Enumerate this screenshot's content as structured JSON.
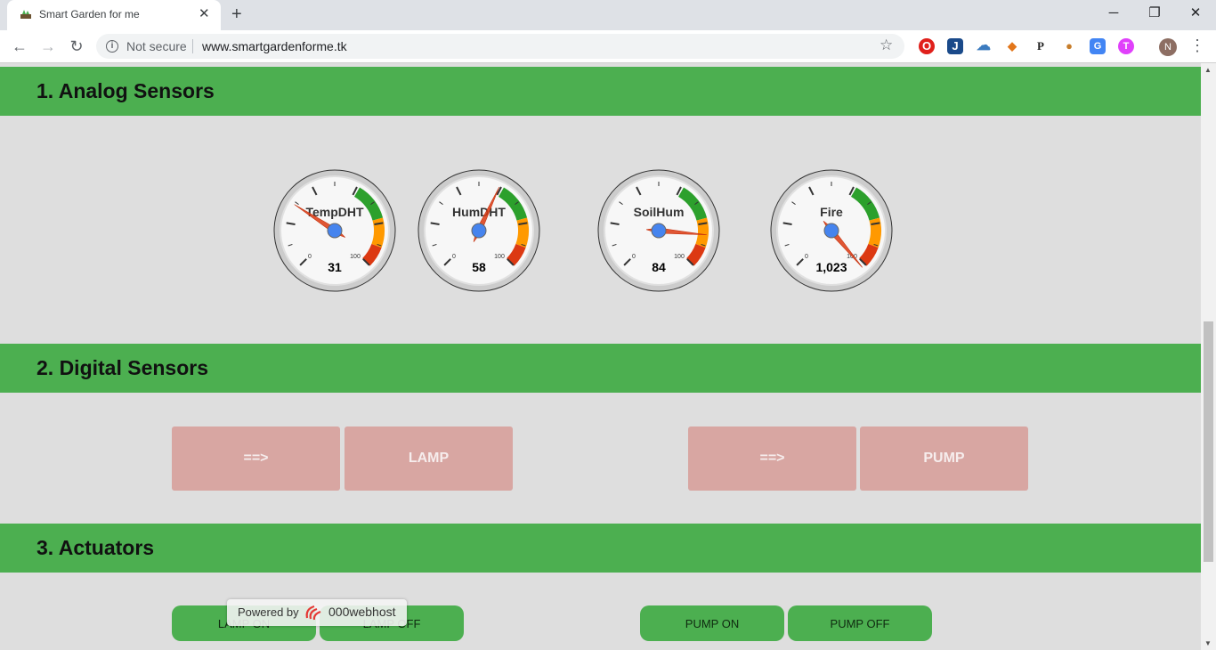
{
  "browser": {
    "tab_title": "Smart Garden for me",
    "security_label": "Not secure",
    "url": "www.smartgardenforme.tk",
    "profile_initial": "N"
  },
  "sections": {
    "analog": "1. Analog Sensors",
    "digital": "2. Digital Sensors",
    "actuators": "3. Actuators"
  },
  "gauges": [
    {
      "label": "TempDHT",
      "value": 31,
      "display": "31",
      "needle_angle": -57
    },
    {
      "label": "HumDHT",
      "value": 58,
      "display": "58",
      "needle_angle": 25
    },
    {
      "label": "SoilHum",
      "value": 84,
      "display": "84",
      "needle_angle": 95
    },
    {
      "label": "Fire",
      "value": 1023,
      "display": "1,023",
      "needle_angle": 140
    }
  ],
  "gauge_scale": {
    "min_label": "0",
    "max_label": "100"
  },
  "digital": {
    "lamp_arrow": "==>",
    "lamp_label": "LAMP",
    "pump_arrow": "==>",
    "pump_label": "PUMP"
  },
  "actuators": {
    "lamp_on": "LAMP ON",
    "lamp_off": "LAMP OFF",
    "pump_on": "PUMP ON",
    "pump_off": "PUMP OFF"
  },
  "footer_badge": {
    "powered_by": "Powered by",
    "brand": "000webhost"
  },
  "colors": {
    "section_green": "#4caf50",
    "digital_box": "#d8a6a2",
    "gauge_green": "#2ca02c",
    "gauge_orange": "#ff9900",
    "gauge_red": "#dc3912",
    "needle": "#dc3912",
    "gauge_center": "#4684ee"
  }
}
